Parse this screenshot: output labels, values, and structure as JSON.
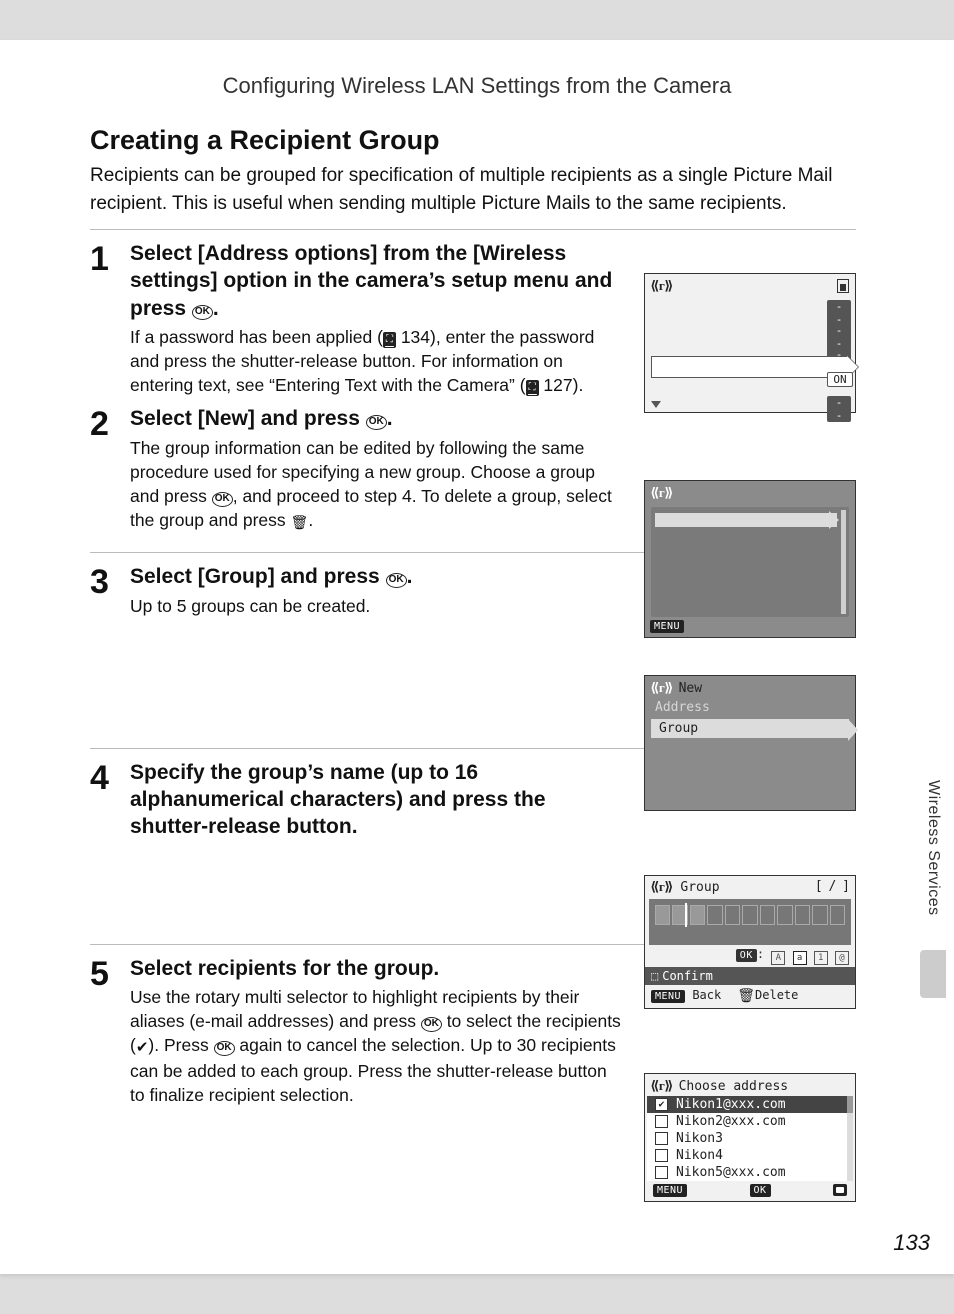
{
  "header": {
    "title": "Configuring Wireless LAN Settings from the Camera"
  },
  "section": {
    "heading": "Creating a Recipient Group",
    "intro": "Recipients can be grouped for specification of multiple recipients as a single Picture Mail recipient. This is useful when sending multiple Picture Mails to the same recipients."
  },
  "steps": {
    "s1": {
      "num": "1",
      "title_a": "Select [Address options] from the [Wireless settings] option in the camera’s setup menu and press ",
      "title_b": ".",
      "desc_a": "If a password has been applied (",
      "desc_ref1": " 134",
      "desc_b": "), enter the password and press the shutter-release button. For information on entering text, see “Entering Text with the Camera” (",
      "desc_ref2": " 127",
      "desc_c": ")."
    },
    "s2": {
      "num": "2",
      "title_a": "Select [New] and press ",
      "title_b": ".",
      "desc_a": "The group information can be edited by following the same procedure used for specifying a new group. Choose a group and press ",
      "desc_b": ", and proceed to step 4. To delete a group, select the group and press ",
      "desc_c": "."
    },
    "s3": {
      "num": "3",
      "title_a": "Select [Group] and press ",
      "title_b": ".",
      "desc": "Up to 5 groups can be created."
    },
    "s4": {
      "num": "4",
      "title": "Specify the group’s name (up to 16 alphanumerical characters) and press the shutter-release button."
    },
    "s5": {
      "num": "5",
      "title": "Select recipients for the group.",
      "desc_a": "Use the rotary multi selector to highlight recipients by their aliases (e-mail addresses) and press ",
      "desc_b": " to select the recipients (",
      "desc_c": "). Press ",
      "desc_d": " again to cancel the selection. Up to 30 recipients can be added to each group. Press the shutter-release button to finalize recipient selection."
    }
  },
  "lcd": {
    "screen1": {
      "dashes": "- -",
      "on": "ON"
    },
    "screen2": {
      "menu": "MENU"
    },
    "screen3": {
      "new": "New",
      "address": "Address",
      "group": "Group"
    },
    "screen4": {
      "title": "Group",
      "counter": "[      /     ]",
      "ok_prefix": "OK",
      "confirm": "Confirm",
      "back_label": "Back",
      "delete_label": "Delete",
      "menu": "MENU"
    },
    "screen5": {
      "title": "Choose address",
      "items": [
        {
          "label": "Nikon1@xxx.com",
          "checked": true,
          "selected": true
        },
        {
          "label": "Nikon2@xxx.com",
          "checked": false,
          "selected": false
        },
        {
          "label": "Nikon3",
          "checked": false,
          "selected": false
        },
        {
          "label": "Nikon4",
          "checked": false,
          "selected": false
        },
        {
          "label": "Nikon5@xxx.com",
          "checked": false,
          "selected": false
        }
      ],
      "menu": "MENU",
      "ok": "OK"
    }
  },
  "side_tab": "Wireless Services",
  "page_number": "133",
  "icons": {
    "ok": "OK",
    "check": "✔",
    "trash": "🗑",
    "antenna": "⟪ᴦ⟫",
    "shutter": "⬚",
    "manual_glyph": "⛶"
  }
}
